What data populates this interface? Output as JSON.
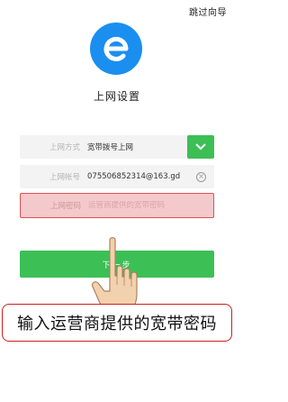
{
  "header": {
    "skip_label": "跳过向导"
  },
  "app": {
    "title": "上网设置",
    "logo_icon": "browser-e-logo-icon",
    "brand_color": "#1a8ff0"
  },
  "form": {
    "mode": {
      "label": "上网方式",
      "value": "宽带拨号上网"
    },
    "account": {
      "label": "上网帐号",
      "value": "075506852314@163.gd"
    },
    "password": {
      "label": "上网密码",
      "placeholder": "运营商提供的宽带密码",
      "value": ""
    }
  },
  "actions": {
    "next_label": "下一步",
    "accent_color": "#3cbf55"
  },
  "annotation": {
    "text": "输入运营商提供的宽带密码",
    "border_color": "#cc1f1f"
  }
}
